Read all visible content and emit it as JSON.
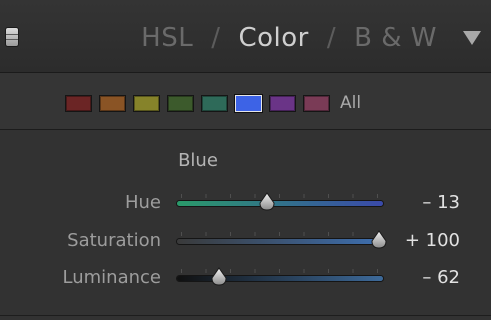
{
  "header": {
    "tabs": [
      {
        "label": "HSL",
        "active": false
      },
      {
        "label": "Color",
        "active": true
      },
      {
        "label": "B & W",
        "active": false
      }
    ],
    "separator": "/",
    "menu_icon": "triangle-down-icon"
  },
  "swatches": {
    "colors": [
      "#6b2525",
      "#8a5425",
      "#86832a",
      "#3c5a2c",
      "#2e6a59",
      "#3d63e6",
      "#6a3487",
      "#7a3b56"
    ],
    "selected_index": 5,
    "all_label": "All"
  },
  "color_panel": {
    "title": "Blue",
    "sliders": [
      {
        "label": "Hue",
        "value_text": "– 13",
        "value": -13,
        "min": -100,
        "max": 100,
        "track_colors": [
          "#2a9a6a",
          "#3a4aaa"
        ]
      },
      {
        "label": "Saturation",
        "value_text": "+ 100",
        "value": 100,
        "min": -100,
        "max": 100,
        "track_colors": [
          "#3a3a3a",
          "#3d6fb0"
        ]
      },
      {
        "label": "Luminance",
        "value_text": "– 62",
        "value": -62,
        "min": -100,
        "max": 100,
        "track_colors": [
          "#101010",
          "#3d6a9a"
        ]
      }
    ]
  }
}
